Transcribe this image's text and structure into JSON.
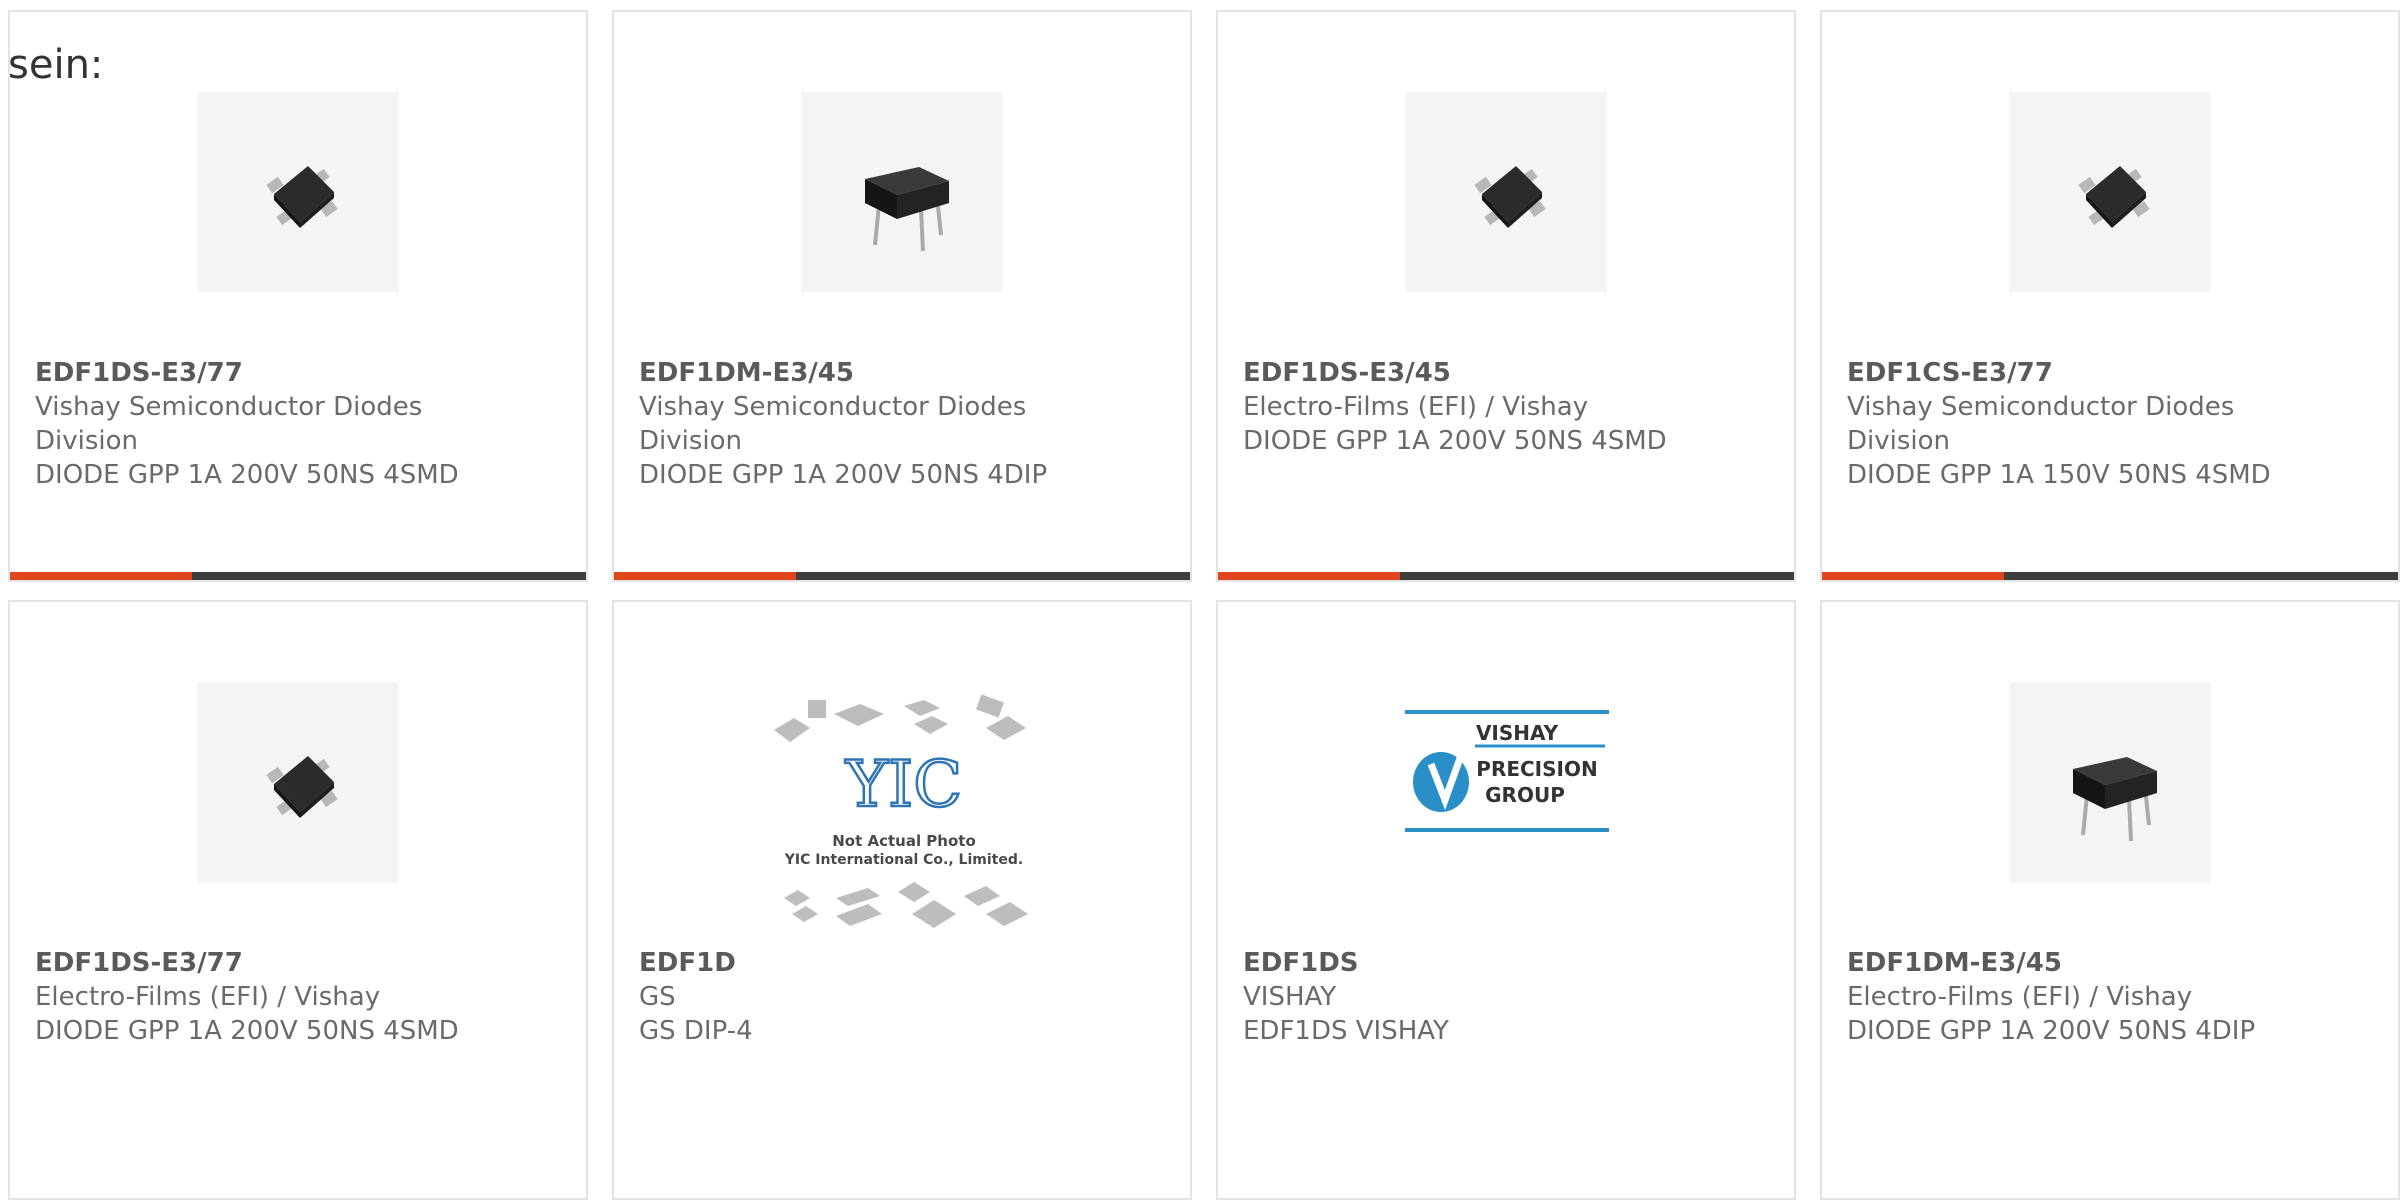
{
  "intro_text": "sein:",
  "accent_color": "#e0461b",
  "cards": [
    {
      "part": "EDF1DS-E3/77",
      "manufacturer": "Vishay Semiconductor Diodes Division",
      "description": "DIODE GPP 1A 200V 50NS 4SMD",
      "image": "smd-bridge-chip"
    },
    {
      "part": "EDF1DM-E3/45",
      "manufacturer": "Vishay Semiconductor Diodes Division",
      "description": "DIODE GPP 1A 200V 50NS 4DIP",
      "image": "dip-bridge-chip"
    },
    {
      "part": "EDF1DS-E3/45",
      "manufacturer": "Electro-Films (EFI) / Vishay",
      "description": "DIODE GPP 1A 200V 50NS 4SMD",
      "image": "smd-bridge-chip"
    },
    {
      "part": "EDF1CS-E3/77",
      "manufacturer": "Vishay Semiconductor Diodes Division",
      "description": "DIODE GPP 1A 150V 50NS 4SMD",
      "image": "smd-bridge-chip"
    },
    {
      "part": "EDF1DS-E3/77",
      "manufacturer": "Electro-Films (EFI) / Vishay",
      "description": "DIODE GPP 1A 200V 50NS 4SMD",
      "image": "smd-bridge-chip"
    },
    {
      "part": "EDF1D",
      "manufacturer": "GS",
      "description": "GS DIP-4",
      "image": "yic-placeholder",
      "image_caption_1": "Not Actual Photo",
      "image_caption_2": "YIC International Co., Limited.",
      "logo_text": "YIC"
    },
    {
      "part": "EDF1DS",
      "manufacturer": "VISHAY",
      "description": "EDF1DS VISHAY",
      "image": "vishay-logo",
      "logo_line_1": "VISHAY",
      "logo_line_2": "PRECISION",
      "logo_line_3": "GROUP"
    },
    {
      "part": "EDF1DM-E3/45",
      "manufacturer": "Electro-Films (EFI) / Vishay",
      "description": "DIODE GPP 1A 200V 50NS 4DIP",
      "image": "dip-bridge-chip"
    }
  ]
}
